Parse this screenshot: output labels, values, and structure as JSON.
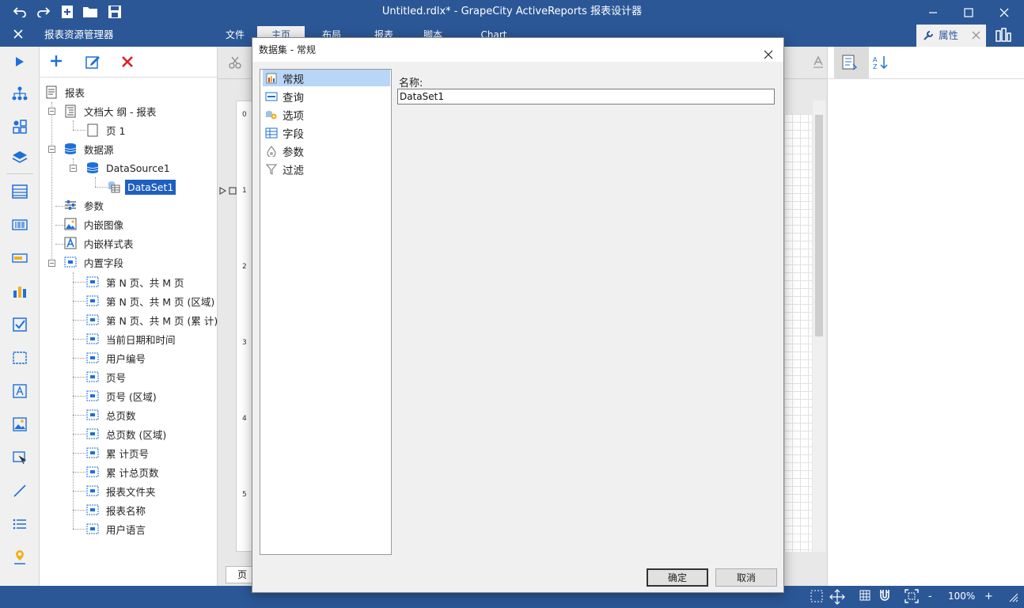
{
  "window": {
    "title": "Untitled.rdlx* - GrapeCity ActiveReports 报表设计器"
  },
  "menu": {
    "tabs": [
      "文件",
      "主页",
      "布局",
      "报表",
      "脚本",
      "Chart"
    ],
    "active": "主页"
  },
  "explorer": {
    "title": "报表资源管理器"
  },
  "props_panel": {
    "title": "属性"
  },
  "tree": {
    "root": "报表",
    "document_outline": "文档大 纲 - 报表",
    "page": "页 1",
    "datasources": "数据源",
    "datasource": "DataSource1",
    "dataset": "DataSet1",
    "parameters": "参数",
    "embedded_images": "内嵌图像",
    "embedded_stylesheets": "内嵌样式表",
    "builtin_fields": "内置字段",
    "fields": [
      "第 N 页、共 M 页",
      "第 N 页、共 M 页 (区域)",
      "第 N 页、共 M 页 (累 计)",
      "当前日期和时间",
      "用户编号",
      "页号",
      "页号 (区域)",
      "总页数",
      "总页数 (区域)",
      "累 计页号",
      "累 计总页数",
      "报表文件夹",
      "报表名称",
      "用户语言"
    ]
  },
  "ruler": {
    "marks": [
      "0",
      "1",
      "2",
      "3",
      "4",
      "5"
    ]
  },
  "designer": {
    "page_tab": "页"
  },
  "status": {
    "zoom": "100%",
    "minus": "-",
    "plus": "+"
  },
  "dialog": {
    "title": "数据集 - 常规",
    "nav": [
      "常规",
      "查询",
      "选项",
      "字段",
      "参数",
      "过滤"
    ],
    "selected": "常规",
    "name_label": "名称:",
    "name_value": "DataSet1",
    "ok": "确定",
    "cancel": "取消"
  },
  "colors": {
    "chrome": "#2b5797",
    "selection": "#b8d6f5",
    "tree_selected": "#1f5fbf",
    "delete_red": "#e02020"
  }
}
